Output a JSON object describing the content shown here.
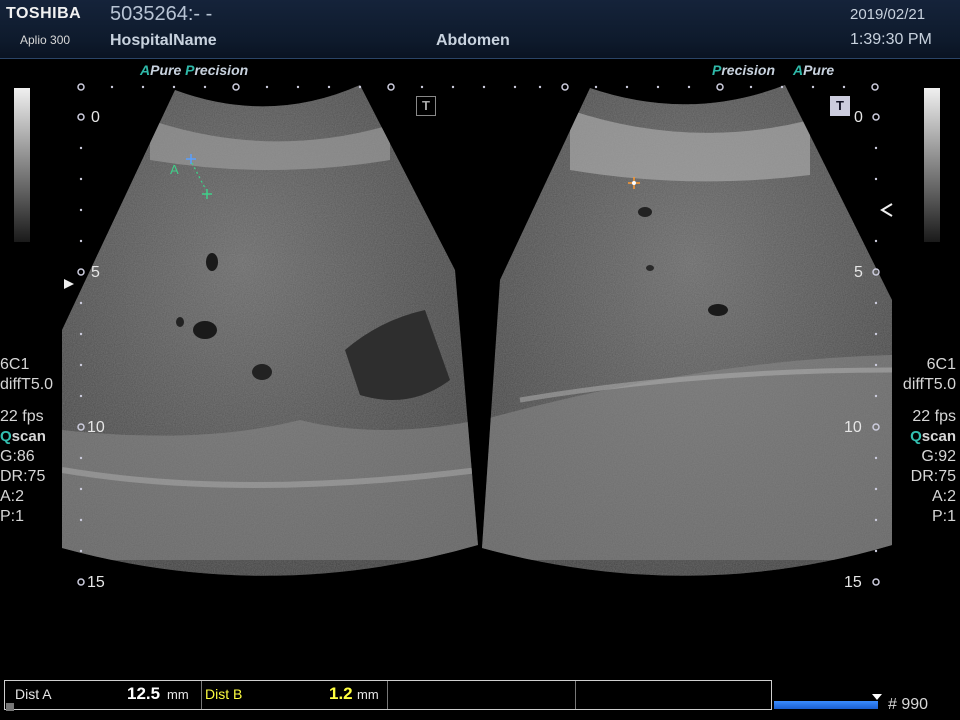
{
  "header": {
    "brand": "TOSHIBA",
    "model": "Aplio 300",
    "patient_id": "5035264:- -",
    "hospital": "HospitalName",
    "exam": "Abdomen",
    "date": "2019/02/21",
    "time": "1:39:30 PM"
  },
  "left_panel": {
    "mode_a": "A",
    "mode_pure": "Pure",
    "mode_p": "P",
    "mode_precision": "recision",
    "depth_labels": [
      "0",
      "5",
      "10",
      "15"
    ],
    "probe": "6C1",
    "preset": "diffT5.0",
    "fps": "22 fps",
    "qscan_q": "Q",
    "qscan_rest": "scan",
    "gain": "G:86",
    "dr": "DR:75",
    "a": "A:2",
    "p": "P:1",
    "caliper_label": "A"
  },
  "right_panel": {
    "mode_p": "P",
    "mode_precision": "recision",
    "mode_a": "A",
    "mode_pure": "Pure",
    "depth_labels": [
      "0",
      "5",
      "10",
      "15"
    ],
    "probe": "6C1",
    "preset": "diffT5.0",
    "fps": "22 fps",
    "qscan_q": "Q",
    "qscan_rest": "scan",
    "gain": "G:92",
    "dr": "DR:75",
    "a": "A:2",
    "p": "P:1"
  },
  "t_icon": "T",
  "measurements": [
    {
      "label": "Dist A",
      "value": "12.5",
      "unit": "mm",
      "value_color": "#ffffff",
      "label_color": "#e6e6e6"
    },
    {
      "label": "Dist B",
      "value": "1.2",
      "unit": "mm",
      "value_color": "#ffff40",
      "label_color": "#ffff40"
    }
  ],
  "frame_counter": "# 990",
  "colors": {
    "accent_teal": "#2fb9a9",
    "caliper_green": "#3fd08a",
    "caliper_blue": "#5aa0ff",
    "caliper_orange": "#ff9a30",
    "progress_blue": "#2a7fff"
  }
}
